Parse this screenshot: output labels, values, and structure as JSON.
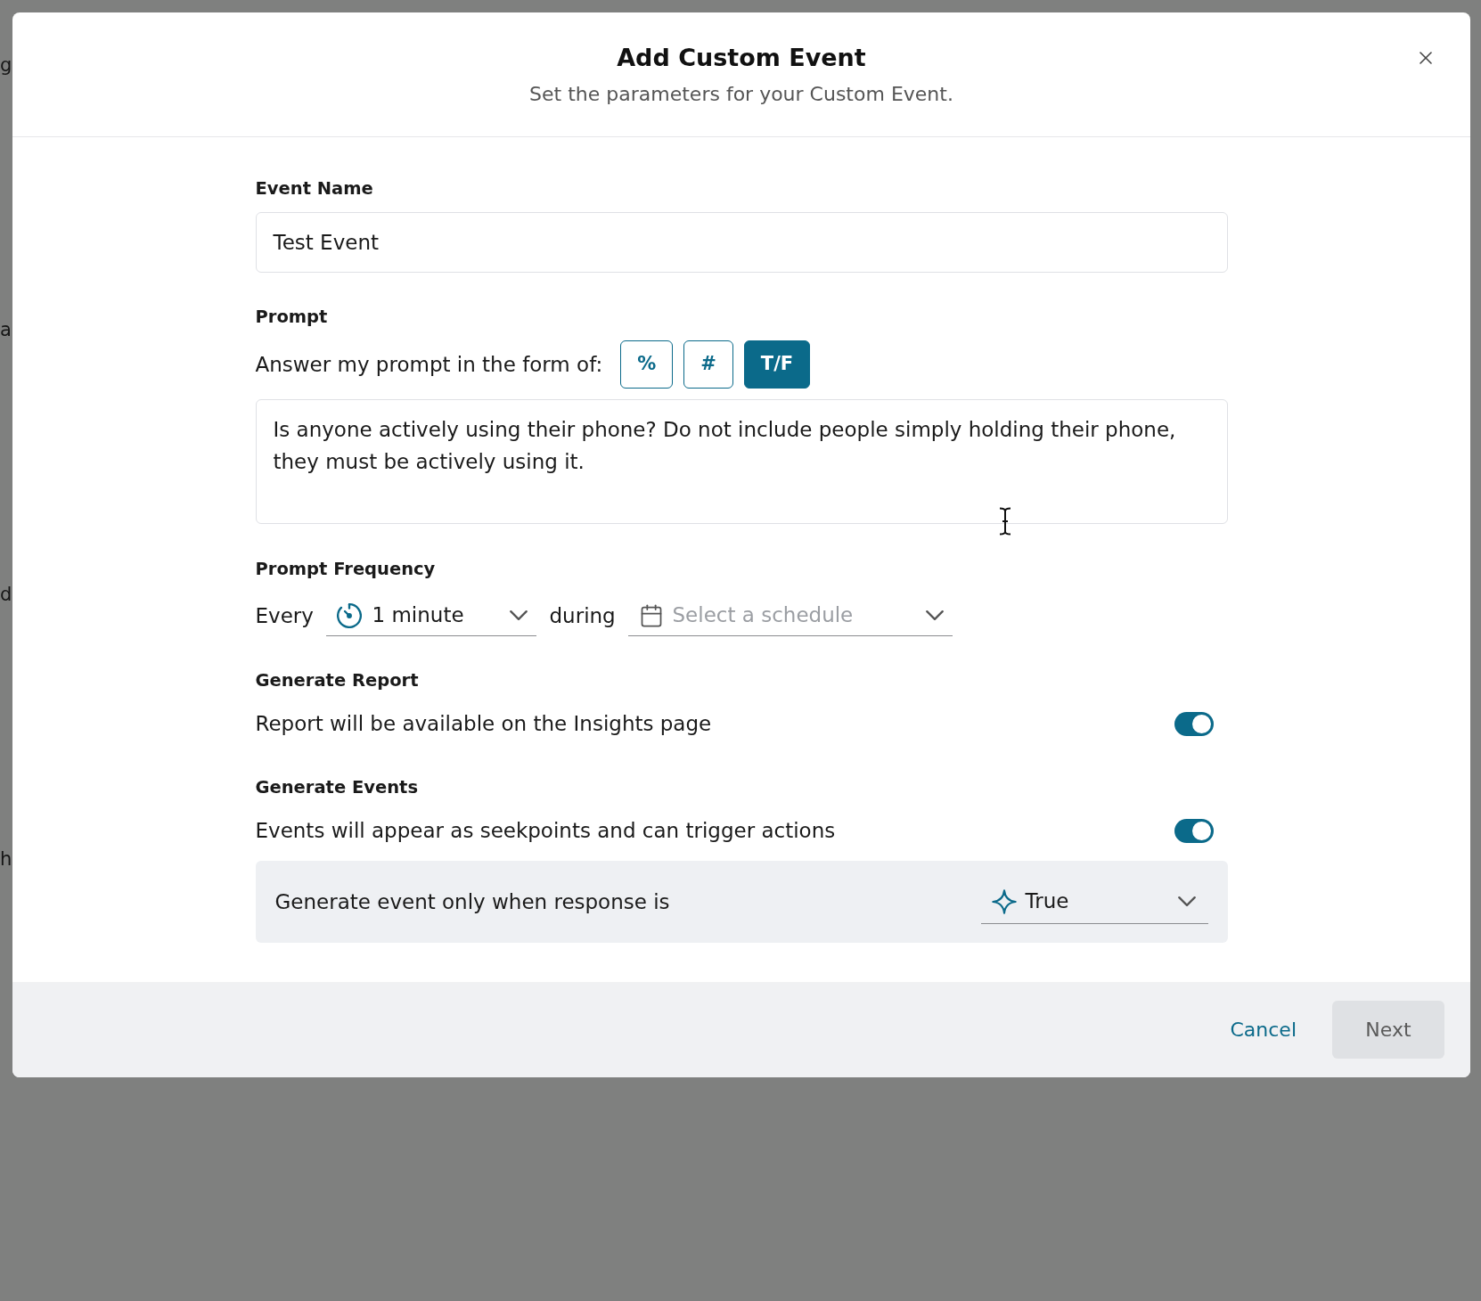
{
  "background": {
    "fragments": [
      "g",
      "a",
      "d",
      "h"
    ]
  },
  "dialog": {
    "title": "Add Custom Event",
    "subtitle": "Set the parameters for your Custom Event."
  },
  "event_name": {
    "label": "Event Name",
    "value": "Test Event"
  },
  "prompt": {
    "label": "Prompt",
    "format_label": "Answer my prompt in the form of:",
    "formats": [
      {
        "label": "%",
        "selected": false
      },
      {
        "label": "#",
        "selected": false
      },
      {
        "label": "T/F",
        "selected": true
      }
    ],
    "value": "Is anyone actively using their phone? Do not include people simply holding their phone, they must be actively using it."
  },
  "frequency": {
    "label": "Prompt Frequency",
    "every_label": "Every",
    "interval": {
      "value": "1 minute"
    },
    "during_label": "during",
    "schedule": {
      "placeholder": "Select a schedule"
    }
  },
  "report": {
    "label": "Generate Report",
    "description": "Report will be available on the Insights page",
    "on": true
  },
  "events": {
    "label": "Generate Events",
    "description": "Events will appear as seekpoints and can trigger actions",
    "on": true,
    "condition": {
      "label": "Generate event only when response is",
      "value": "True"
    }
  },
  "footer": {
    "buttons": [
      {
        "label": "Cancel",
        "kind": "text",
        "disabled": false
      },
      {
        "label": "Next",
        "kind": "filled",
        "disabled": true
      }
    ]
  }
}
